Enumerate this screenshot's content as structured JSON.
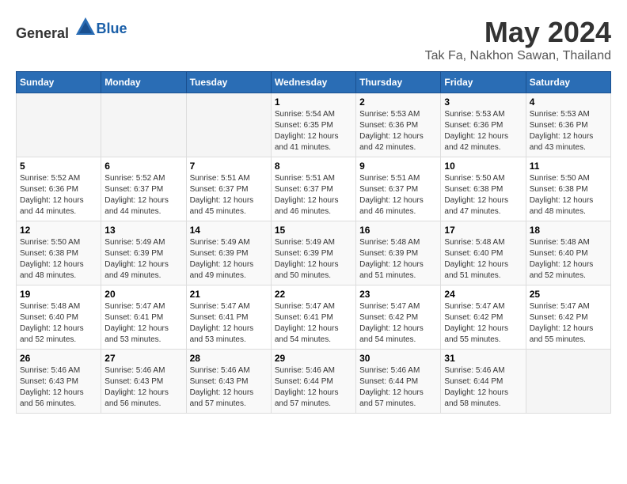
{
  "header": {
    "logo_general": "General",
    "logo_blue": "Blue",
    "title": "May 2024",
    "subtitle": "Tak Fa, Nakhon Sawan, Thailand"
  },
  "days_of_week": [
    "Sunday",
    "Monday",
    "Tuesday",
    "Wednesday",
    "Thursday",
    "Friday",
    "Saturday"
  ],
  "weeks": [
    [
      {
        "day": "",
        "info": ""
      },
      {
        "day": "",
        "info": ""
      },
      {
        "day": "",
        "info": ""
      },
      {
        "day": "1",
        "info": "Sunrise: 5:54 AM\nSunset: 6:35 PM\nDaylight: 12 hours\nand 41 minutes."
      },
      {
        "day": "2",
        "info": "Sunrise: 5:53 AM\nSunset: 6:36 PM\nDaylight: 12 hours\nand 42 minutes."
      },
      {
        "day": "3",
        "info": "Sunrise: 5:53 AM\nSunset: 6:36 PM\nDaylight: 12 hours\nand 42 minutes."
      },
      {
        "day": "4",
        "info": "Sunrise: 5:53 AM\nSunset: 6:36 PM\nDaylight: 12 hours\nand 43 minutes."
      }
    ],
    [
      {
        "day": "5",
        "info": "Sunrise: 5:52 AM\nSunset: 6:36 PM\nDaylight: 12 hours\nand 44 minutes."
      },
      {
        "day": "6",
        "info": "Sunrise: 5:52 AM\nSunset: 6:37 PM\nDaylight: 12 hours\nand 44 minutes."
      },
      {
        "day": "7",
        "info": "Sunrise: 5:51 AM\nSunset: 6:37 PM\nDaylight: 12 hours\nand 45 minutes."
      },
      {
        "day": "8",
        "info": "Sunrise: 5:51 AM\nSunset: 6:37 PM\nDaylight: 12 hours\nand 46 minutes."
      },
      {
        "day": "9",
        "info": "Sunrise: 5:51 AM\nSunset: 6:37 PM\nDaylight: 12 hours\nand 46 minutes."
      },
      {
        "day": "10",
        "info": "Sunrise: 5:50 AM\nSunset: 6:38 PM\nDaylight: 12 hours\nand 47 minutes."
      },
      {
        "day": "11",
        "info": "Sunrise: 5:50 AM\nSunset: 6:38 PM\nDaylight: 12 hours\nand 48 minutes."
      }
    ],
    [
      {
        "day": "12",
        "info": "Sunrise: 5:50 AM\nSunset: 6:38 PM\nDaylight: 12 hours\nand 48 minutes."
      },
      {
        "day": "13",
        "info": "Sunrise: 5:49 AM\nSunset: 6:39 PM\nDaylight: 12 hours\nand 49 minutes."
      },
      {
        "day": "14",
        "info": "Sunrise: 5:49 AM\nSunset: 6:39 PM\nDaylight: 12 hours\nand 49 minutes."
      },
      {
        "day": "15",
        "info": "Sunrise: 5:49 AM\nSunset: 6:39 PM\nDaylight: 12 hours\nand 50 minutes."
      },
      {
        "day": "16",
        "info": "Sunrise: 5:48 AM\nSunset: 6:39 PM\nDaylight: 12 hours\nand 51 minutes."
      },
      {
        "day": "17",
        "info": "Sunrise: 5:48 AM\nSunset: 6:40 PM\nDaylight: 12 hours\nand 51 minutes."
      },
      {
        "day": "18",
        "info": "Sunrise: 5:48 AM\nSunset: 6:40 PM\nDaylight: 12 hours\nand 52 minutes."
      }
    ],
    [
      {
        "day": "19",
        "info": "Sunrise: 5:48 AM\nSunset: 6:40 PM\nDaylight: 12 hours\nand 52 minutes."
      },
      {
        "day": "20",
        "info": "Sunrise: 5:47 AM\nSunset: 6:41 PM\nDaylight: 12 hours\nand 53 minutes."
      },
      {
        "day": "21",
        "info": "Sunrise: 5:47 AM\nSunset: 6:41 PM\nDaylight: 12 hours\nand 53 minutes."
      },
      {
        "day": "22",
        "info": "Sunrise: 5:47 AM\nSunset: 6:41 PM\nDaylight: 12 hours\nand 54 minutes."
      },
      {
        "day": "23",
        "info": "Sunrise: 5:47 AM\nSunset: 6:42 PM\nDaylight: 12 hours\nand 54 minutes."
      },
      {
        "day": "24",
        "info": "Sunrise: 5:47 AM\nSunset: 6:42 PM\nDaylight: 12 hours\nand 55 minutes."
      },
      {
        "day": "25",
        "info": "Sunrise: 5:47 AM\nSunset: 6:42 PM\nDaylight: 12 hours\nand 55 minutes."
      }
    ],
    [
      {
        "day": "26",
        "info": "Sunrise: 5:46 AM\nSunset: 6:43 PM\nDaylight: 12 hours\nand 56 minutes."
      },
      {
        "day": "27",
        "info": "Sunrise: 5:46 AM\nSunset: 6:43 PM\nDaylight: 12 hours\nand 56 minutes."
      },
      {
        "day": "28",
        "info": "Sunrise: 5:46 AM\nSunset: 6:43 PM\nDaylight: 12 hours\nand 57 minutes."
      },
      {
        "day": "29",
        "info": "Sunrise: 5:46 AM\nSunset: 6:44 PM\nDaylight: 12 hours\nand 57 minutes."
      },
      {
        "day": "30",
        "info": "Sunrise: 5:46 AM\nSunset: 6:44 PM\nDaylight: 12 hours\nand 57 minutes."
      },
      {
        "day": "31",
        "info": "Sunrise: 5:46 AM\nSunset: 6:44 PM\nDaylight: 12 hours\nand 58 minutes."
      },
      {
        "day": "",
        "info": ""
      }
    ]
  ]
}
